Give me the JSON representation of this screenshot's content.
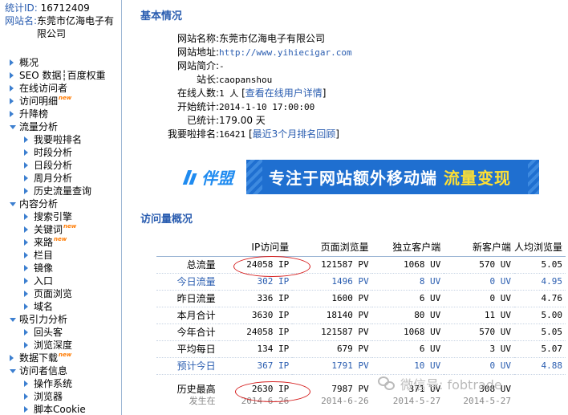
{
  "site": {
    "id_label": "统计ID:",
    "id_value": "16712409",
    "name_label": "网站名:",
    "name_value": "东莞市亿海电子有限公司"
  },
  "nav": [
    {
      "label": "概况",
      "level": 0,
      "open": false
    },
    {
      "label": "SEO 数据┆百度权重",
      "level": 0,
      "open": false
    },
    {
      "label": "在线访问者",
      "level": 0,
      "open": false
    },
    {
      "label": "访问明细",
      "level": 0,
      "open": false,
      "tag": "new"
    },
    {
      "label": "升降榜",
      "level": 0,
      "open": false
    },
    {
      "label": "流量分析",
      "level": 0,
      "open": true
    },
    {
      "label": "我要啦排名",
      "level": 1,
      "open": false
    },
    {
      "label": "时段分析",
      "level": 1,
      "open": false
    },
    {
      "label": "日段分析",
      "level": 1,
      "open": false
    },
    {
      "label": "周月分析",
      "level": 1,
      "open": false
    },
    {
      "label": "历史流量查询",
      "level": 1,
      "open": false
    },
    {
      "label": "内容分析",
      "level": 0,
      "open": true
    },
    {
      "label": "搜索引擎",
      "level": 1,
      "open": false
    },
    {
      "label": "关键词",
      "level": 1,
      "open": false,
      "tag": "new"
    },
    {
      "label": "来路",
      "level": 1,
      "open": false,
      "tag": "new"
    },
    {
      "label": "栏目",
      "level": 1,
      "open": false
    },
    {
      "label": "镜像",
      "level": 1,
      "open": false
    },
    {
      "label": "入口",
      "level": 1,
      "open": false
    },
    {
      "label": "页面浏览",
      "level": 1,
      "open": false
    },
    {
      "label": "域名",
      "level": 1,
      "open": false
    },
    {
      "label": "吸引力分析",
      "level": 0,
      "open": true
    },
    {
      "label": "回头客",
      "level": 1,
      "open": false
    },
    {
      "label": "浏览深度",
      "level": 1,
      "open": false
    },
    {
      "label": "数据下载",
      "level": 0,
      "open": false,
      "tag": "new"
    },
    {
      "label": "访问者信息",
      "level": 0,
      "open": true
    },
    {
      "label": "操作系统",
      "level": 1,
      "open": false
    },
    {
      "label": "浏览器",
      "level": 1,
      "open": false
    },
    {
      "label": "脚本Cookie",
      "level": 1,
      "open": false
    }
  ],
  "new_tag": "new",
  "basic": {
    "title": "基本情况",
    "rows": [
      {
        "key": "网站名称:",
        "value": "东莞市亿海电子有限公司",
        "cjk": true
      },
      {
        "key": "网站地址:",
        "value": "http://www.yihiecigar.com",
        "link": true
      },
      {
        "key": "网站简介:",
        "value": "-"
      },
      {
        "key": "站长:",
        "value": "caopanshou"
      },
      {
        "key": "在线人数:",
        "value": "1 人",
        "extra_pre": " [",
        "extra": "查看在线用户详情",
        "extra_post": "]"
      },
      {
        "key": "开始统计:",
        "value": "2014-1-10 17:00:00"
      },
      {
        "key": "已统计:",
        "value": "179.00 天",
        "cjk": true
      },
      {
        "key": "我要啦排名:",
        "value": "16421",
        "extra_pre": " [",
        "extra": "最近3个月排名回顾",
        "extra_post": "]"
      }
    ]
  },
  "banner": {
    "logo": "伴盟",
    "slogan": "专注于网站额外移动端",
    "highlight": "流量变现"
  },
  "overview": {
    "title": "访问量概况",
    "headers": [
      "",
      "IP访问量",
      "页面浏览量",
      "独立客户端",
      "新客户端",
      "人均浏览量"
    ],
    "rows": [
      {
        "label": "总流量",
        "cells": [
          "24058 IP",
          "121587 PV",
          "1068 UV",
          "570 UV",
          "5.05"
        ],
        "highlight": false
      },
      {
        "label": "今日流量",
        "cells": [
          "302 IP",
          "1496 PV",
          "8 UV",
          "0 UV",
          "4.95"
        ],
        "highlight": true
      },
      {
        "label": "昨日流量",
        "cells": [
          "336 IP",
          "1600 PV",
          "6 UV",
          "0 UV",
          "4.76"
        ],
        "highlight": false
      },
      {
        "label": "本月合计",
        "cells": [
          "3630 IP",
          "18140 PV",
          "80 UV",
          "11 UV",
          "5.00"
        ],
        "highlight": false
      },
      {
        "label": "今年合计",
        "cells": [
          "24058 IP",
          "121587 PV",
          "1068 UV",
          "570 UV",
          "5.05"
        ],
        "highlight": false
      },
      {
        "label": "平均每日",
        "cells": [
          "134 IP",
          "679 PV",
          "6 UV",
          "3 UV",
          "5.07"
        ],
        "highlight": false
      },
      {
        "label": "预计今日",
        "cells": [
          "367 IP",
          "1791 PV",
          "10 UV",
          "0 UV",
          "4.88"
        ],
        "highlight": true
      }
    ],
    "history": {
      "label": "历史最高",
      "cells": [
        "2630 IP",
        "7987 PV",
        "371 UV",
        "308 UV",
        ""
      ]
    },
    "history_date": {
      "label": "发生在",
      "cells": [
        "2014-6-26",
        "2014-6-26",
        "2014-5-27",
        "2014-5-27",
        ""
      ]
    }
  },
  "watermark": "微信号: fobtrade",
  "colors": {
    "accent": "#2a5db0",
    "circle": "#d62020",
    "new_tag": "#ff7a00"
  }
}
